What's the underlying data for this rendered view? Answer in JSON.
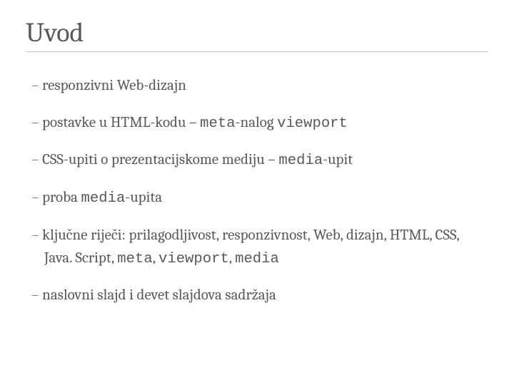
{
  "title": "Uvod",
  "bullets": {
    "b1": {
      "t1": "responzivni Web-dizajn"
    },
    "b2": {
      "t1": "postavke u HTML-kodu – ",
      "code1": "meta",
      "t2": "-nalog ",
      "code2": "viewport"
    },
    "b3": {
      "t1": "CSS-upiti o prezentacijskome mediju – ",
      "code1": "media",
      "t2": "-upit"
    },
    "b4": {
      "t1": "proba ",
      "code1": "media",
      "t2": "-upita"
    },
    "b5": {
      "t1": "ključne riječi: prilagodljivost, responzivnost, Web, dizajn, HTML, CSS, Java. Script, ",
      "code1": "meta",
      "t2": ", ",
      "code2": "viewport",
      "t3": ", ",
      "code3": "media"
    },
    "b6": {
      "t1": "naslovni slajd i devet slajdova sadržaja"
    }
  }
}
